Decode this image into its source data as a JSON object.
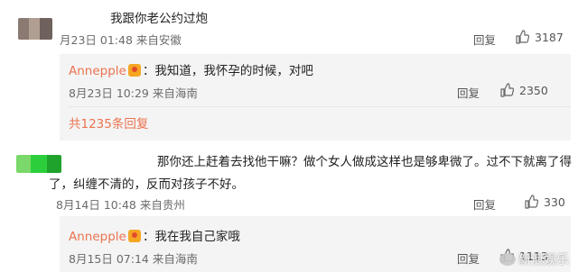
{
  "comment1": {
    "avatar_colors": [
      "#8a7a72",
      "#b09e93",
      "#6f625c"
    ],
    "text": "我跟你老公约过炮",
    "date": "月23日 01:48",
    "location": "来自安徽",
    "reply_label": "回复",
    "likes": "3187"
  },
  "reply1": {
    "user": "Annepple",
    "sep": "：",
    "text": "我知道，我怀孕的时候，对吧",
    "date": "8月23日 10:29",
    "location": "来自海南",
    "reply_label": "回复",
    "likes": "2350"
  },
  "more_replies": "共1235条回复",
  "comment2": {
    "avatar_colors": [
      "#7bd86a",
      "#2ccf3b",
      "#1fa32c"
    ],
    "text_line1": "那你还上赶着去找他干嘛？做个女人做成这样也是够卑微了。过不下就离了得",
    "text_line2": "了，纠缠不清的，反而对孩子不好。",
    "date": "8月14日 10:48",
    "location": "来自贵州",
    "reply_label": "回复",
    "likes": "330"
  },
  "reply2": {
    "user": "Annepple",
    "sep": "：",
    "text": "我在我自己家哦",
    "date": "8月15日 07:14",
    "location": "来自海南",
    "reply_label": "回复",
    "likes": "1113"
  },
  "watermark": "新浪娱乐",
  "colors": {
    "accent": "#eb7350",
    "meta": "#6b6b6b",
    "reply_bg": "#f4f4f4"
  }
}
